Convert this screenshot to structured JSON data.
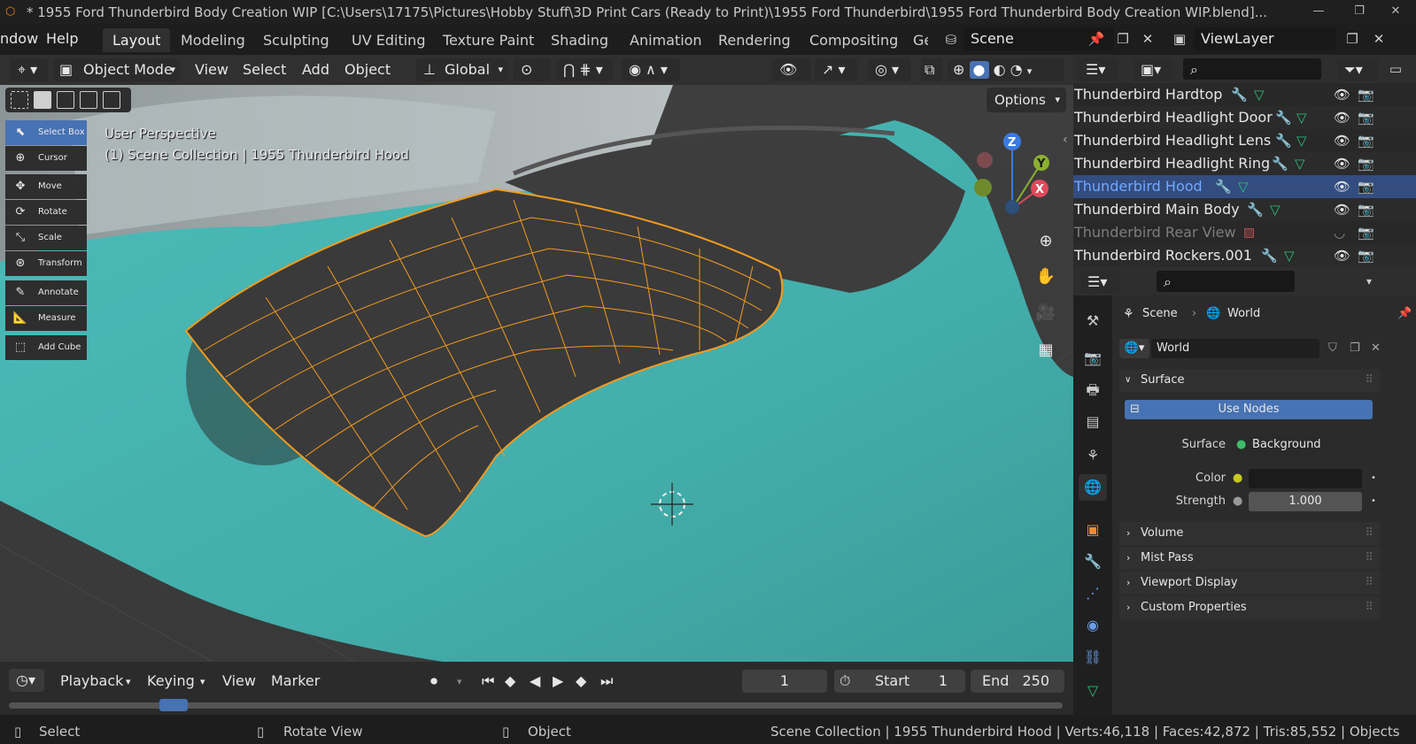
{
  "window": {
    "title": "* 1955 Ford Thunderbird Body Creation WIP [C:\\Users\\17175\\Pictures\\Hobby Stuff\\3D Print Cars (Ready to Print)\\1955 Ford Thunderbird\\1955 Ford Thunderbird Body Creation WIP.blend]..."
  },
  "menu": {
    "items": [
      "ndow",
      "Help"
    ]
  },
  "workspaces": {
    "tabs": [
      "Layout",
      "Modeling",
      "Sculpting",
      "UV Editing",
      "Texture Paint",
      "Shading",
      "Animation",
      "Rendering",
      "Compositing",
      "Geo"
    ],
    "active": "Layout"
  },
  "scene": {
    "name": "Scene",
    "view_layer": "ViewLayer"
  },
  "viewport_header": {
    "mode": "Object Mode",
    "menus": [
      "View",
      "Select",
      "Add",
      "Object"
    ],
    "transform_orientation": "Global",
    "options_label": "Options"
  },
  "viewport": {
    "perspective_label": "User Perspective",
    "collection_label": "(1) Scene Collection | 1955 Thunderbird Hood",
    "gizmo": {
      "z": "Z",
      "y": "Y",
      "x": "X"
    }
  },
  "toolbar": {
    "tools": [
      {
        "label": "Select Box",
        "icon": "cursor-arrow-icon",
        "active": true
      },
      {
        "label": "Cursor",
        "icon": "crosshair-icon",
        "active": false
      },
      {
        "label": "Move",
        "icon": "move-arrows-icon",
        "active": false
      },
      {
        "label": "Rotate",
        "icon": "rotate-icon",
        "active": false
      },
      {
        "label": "Scale",
        "icon": "scale-icon",
        "active": false
      },
      {
        "label": "Transform",
        "icon": "transform-icon",
        "active": false
      },
      {
        "label": "Annotate",
        "icon": "pencil-icon",
        "active": false
      },
      {
        "label": "Measure",
        "icon": "ruler-icon",
        "active": false
      },
      {
        "label": "Add Cube",
        "icon": "cube-add-icon",
        "active": false
      }
    ]
  },
  "timeline": {
    "menus": [
      "Playback",
      "Keying",
      "View",
      "Marker"
    ],
    "current_frame": "1",
    "start_label": "Start",
    "start_value": "1",
    "end_label": "End",
    "end_value": "250"
  },
  "statusbar": {
    "select": "Select",
    "rotate_view": "Rotate View",
    "object": "Object",
    "stats": "Scene Collection | 1955 Thunderbird Hood | Verts:46,118 | Faces:42,872 | Tris:85,552 | Objects"
  },
  "outliner": {
    "rows": [
      {
        "name": "Thunderbird Hardtop",
        "state": "normal"
      },
      {
        "name": "Thunderbird Headlight Door",
        "state": "normal"
      },
      {
        "name": "Thunderbird Headlight Lens",
        "state": "normal"
      },
      {
        "name": "Thunderbird Headlight Ring",
        "state": "normal"
      },
      {
        "name": "Thunderbird Hood",
        "state": "selected"
      },
      {
        "name": "Thunderbird Main Body",
        "state": "normal"
      },
      {
        "name": "Thunderbird Rear View",
        "state": "hidden"
      },
      {
        "name": "Thunderbird Rockers.001",
        "state": "normal"
      }
    ]
  },
  "properties": {
    "breadcrumb": {
      "scene": "Scene",
      "world": "World"
    },
    "world_name": "World",
    "surface_panel": "Surface",
    "use_nodes": "Use Nodes",
    "surface_label": "Surface",
    "surface_value": "Background",
    "color_label": "Color",
    "strength_label": "Strength",
    "strength_value": "1.000",
    "collapsed_panels": [
      "Volume",
      "Mist Pass",
      "Viewport Display",
      "Custom Properties"
    ]
  },
  "colors": {
    "accent_blue": "#4772b3",
    "car_paint": "#46b7b4",
    "wireframe": "#f39b1e",
    "outliner_selected_bg": "#334d80"
  }
}
